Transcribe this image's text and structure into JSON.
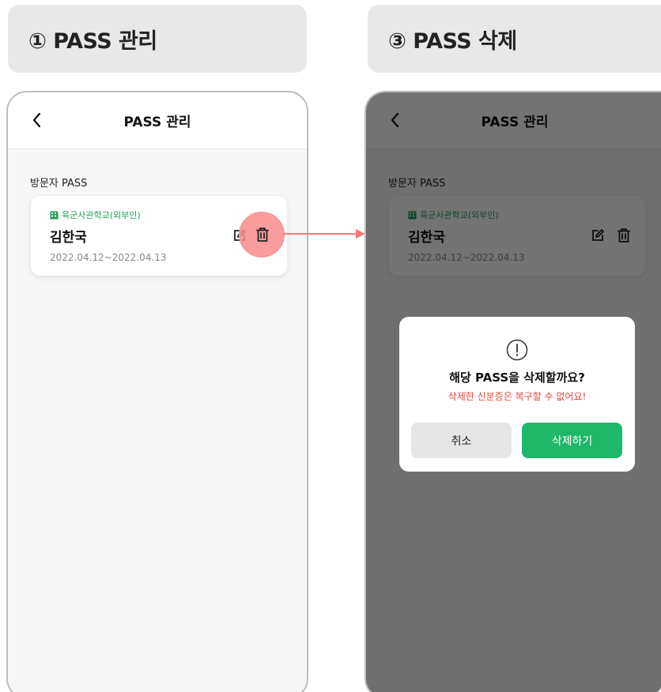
{
  "steps": [
    {
      "label": "① PASS 관리"
    },
    {
      "label": "③ PASS 삭제"
    }
  ],
  "screen": {
    "title": "PASS 관리",
    "section_label": "방문자 PASS",
    "card": {
      "organization": "육군사관학교(외부인)",
      "name": "김한국",
      "dates": "2022.04.12~2022.04.13"
    }
  },
  "dialog": {
    "title": "해당 PASS을 삭제할까요?",
    "warning": "삭제한 신분증은 복구할 수 없어요!",
    "cancel_label": "취소",
    "confirm_label": "삭제하기"
  },
  "colors": {
    "accent_green": "#1fb86a",
    "warning_red": "#e0453b",
    "highlight_red": "#f59a9a"
  },
  "icons": [
    "back-icon",
    "building-icon",
    "edit-icon",
    "trash-icon",
    "alert-icon",
    "arrow-icon"
  ]
}
